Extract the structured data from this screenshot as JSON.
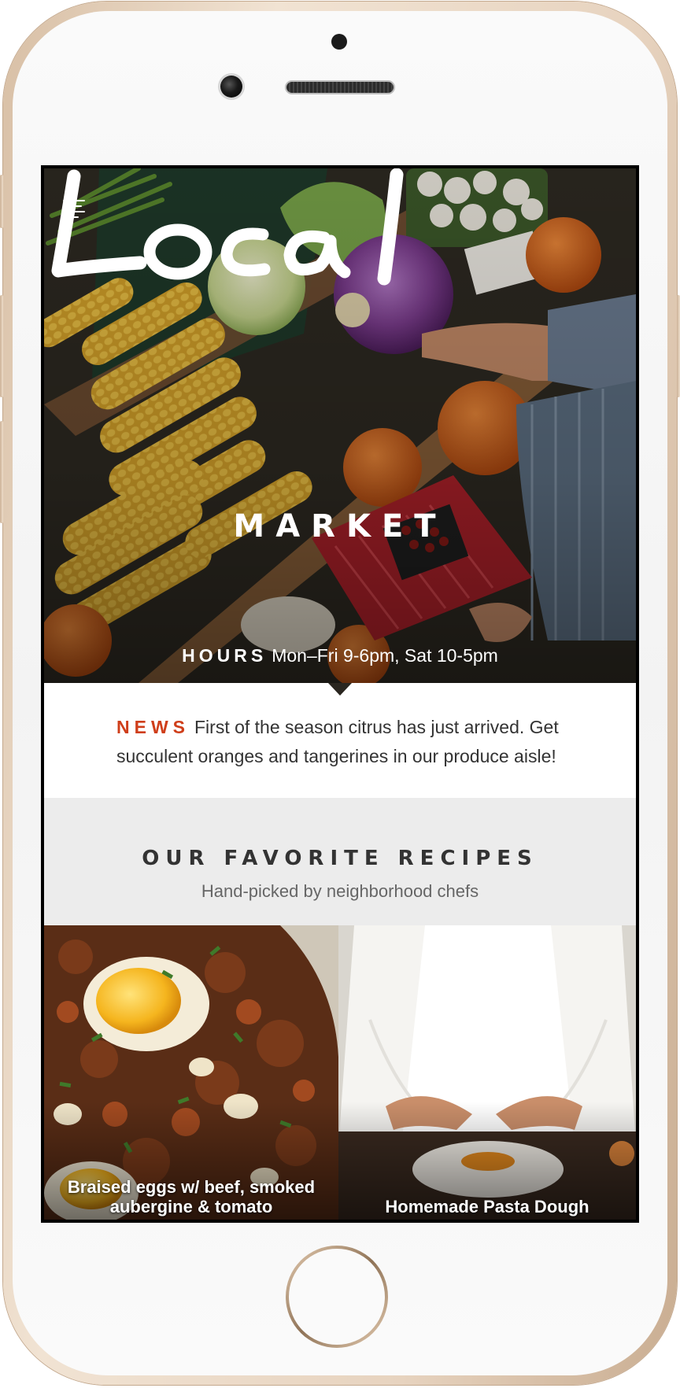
{
  "hero": {
    "title": "Local",
    "subtitle": "MARKET",
    "hours_label": "HOURS",
    "hours_text": "Mon–Fri 9-6pm, Sat 10-5pm"
  },
  "news": {
    "label": "NEWS",
    "text": "First of the season citrus has just arrived. Get succulent oranges and tangerines in our produce aisle!"
  },
  "recipes": {
    "title": "OUR FAVORITE RECIPES",
    "subtitle": "Hand-picked by neighborhood chefs",
    "items": [
      {
        "title": "Braised eggs w/ beef, smoked aubergine & tomato"
      },
      {
        "title": "Homemade Pasta Dough"
      }
    ]
  },
  "colors": {
    "accent": "#cf3e1a",
    "phone_frame": "#e7d3bf"
  },
  "icons": [
    "menu-icon"
  ]
}
